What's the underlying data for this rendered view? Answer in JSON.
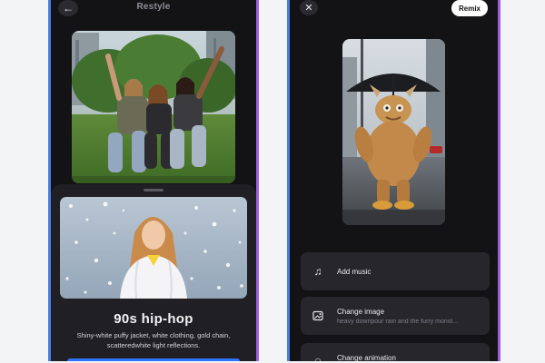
{
  "left_screen": {
    "title": "Restyle",
    "style": {
      "name": "90s hip-hop",
      "description": "Shiny-white puffy jacket, white clothing, gold chain, scatteredwhite light reflections."
    }
  },
  "right_screen": {
    "remix_label": "Remix",
    "options": [
      {
        "icon": "music-note-icon",
        "title": "Add music",
        "subtitle": ""
      },
      {
        "icon": "image-edit-icon",
        "title": "Change image",
        "subtitle": "heavy downpour rain and the furry monst..."
      },
      {
        "icon": "animation-icon",
        "title": "Change animation",
        "subtitle": ""
      }
    ]
  },
  "colors": {
    "phone_background": "#131316",
    "sheet_background": "#202024",
    "option_background": "#26262b",
    "accent_blue": "#2f74ff",
    "frame_gradient_left": "#4a7de0",
    "frame_gradient_right": "#9b5fe0"
  }
}
